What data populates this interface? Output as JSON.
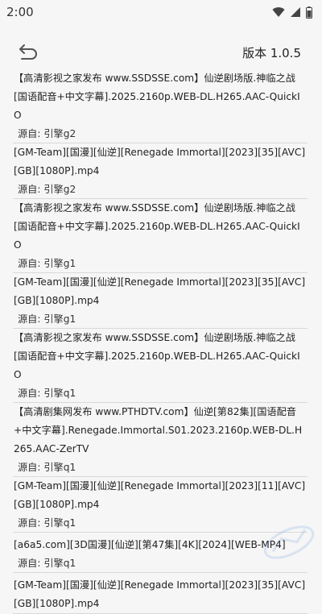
{
  "status_bar": {
    "time": "2:00",
    "icons": [
      "wifi-icon",
      "signal-icon",
      "battery-icon"
    ]
  },
  "header": {
    "version": "版本 1.0.5",
    "back_icon": "back-arrow-icon"
  },
  "items": [
    {
      "title": "【高清影视之家发布 www.SSDSSE.com】仙逆剧场版.神临之战[国语配音+中文字幕].2025.2160p.WEB-DL.H265.AAC-QuickIO",
      "source": "源自: 引擎g2"
    },
    {
      "title": "[GM-Team][国漫][仙逆][Renegade Immortal][2023][35][AVC][GB][1080P].mp4",
      "source": "源自: 引擎g2"
    },
    {
      "title": "【高清影视之家发布 www.SSDSSE.com】仙逆剧场版.神临之战[国语配音+中文字幕].2025.2160p.WEB-DL.H265.AAC-QuickIO",
      "source": "源自: 引擎g1"
    },
    {
      "title": "[GM-Team][国漫][仙逆][Renegade Immortal][2023][35][AVC][GB][1080P].mp4",
      "source": "源自: 引擎g1"
    },
    {
      "title": "【高清影视之家发布 www.SSDSSE.com】仙逆剧场版.神临之战[国语配音+中文字幕].2025.2160p.WEB-DL.H265.AAC-QuickIO",
      "source": "源自: 引擎q1"
    },
    {
      "title": "【高清剧集网发布 www.PTHDTV.com】仙逆[第82集][国语配音+中文字幕].Renegade.Immortal.S01.2023.2160p.WEB-DL.H265.AAC-ZerTV",
      "source": "源自: 引擎q1"
    },
    {
      "title": "[GM-Team][国漫][仙逆][Renegade Immortal][2023][11][AVC][GB][1080P].mp4",
      "source": "源自: 引擎q1"
    },
    {
      "title": "[a6a5.com][3D国漫][仙逆][第47集][4K][2024][WEB-MP4]",
      "source": "源自: 引擎q1"
    },
    {
      "title": "[GM-Team][国漫][仙逆][Renegade Immortal][2023][35][AVC][GB][1080P].mp4",
      "source": ""
    }
  ]
}
